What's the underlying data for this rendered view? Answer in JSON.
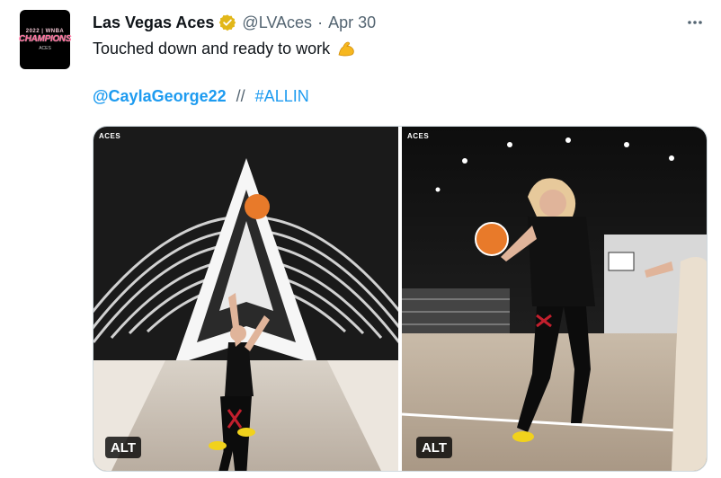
{
  "author": {
    "avatar_top": "2022 | WNBA",
    "avatar_main": "CHAMPIONS",
    "avatar_bottom": "ACES",
    "display_name": "Las Vegas Aces",
    "handle": "@LVAces",
    "separator": "·",
    "date": "Apr 30"
  },
  "tweet": {
    "text": "Touched down and ready to work",
    "mention": "@CaylaGeorge22",
    "slashes": "//",
    "hashtag": "#ALLIN"
  },
  "media": {
    "photos": [
      {
        "watermark": "ACES",
        "alt_label": "ALT",
        "description_icon": "photo"
      },
      {
        "watermark": "ACES",
        "alt_label": "ALT",
        "description_icon": "photo"
      }
    ]
  },
  "colors": {
    "link": "#1d9bf0",
    "muted": "#536471",
    "verified_gold": "#e2b719",
    "border": "#cfd9de"
  },
  "icons": {
    "verified": "verified-badge-icon",
    "more": "more-options-icon",
    "emoji": "flexed-biceps-icon"
  }
}
